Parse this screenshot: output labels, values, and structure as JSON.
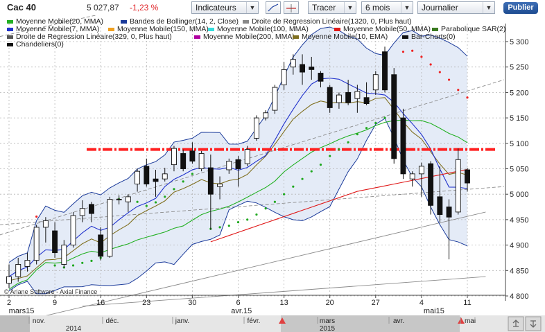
{
  "header": {
    "instrument": "Cac 40",
    "price": "5 027,87",
    "change": "-1,23 %",
    "indicators_label": "Indicateurs",
    "draw_label": "Tracer",
    "period_label": "6 mois",
    "interval_label": "Journalier",
    "publish_label": "Publier"
  },
  "legend": [
    {
      "label": "Moyenne Mobile(20, MMA)",
      "color": "#22b022"
    },
    {
      "label": "Bandes de Bollinger(14, 2, Close)",
      "color": "#1a3a9a"
    },
    {
      "label": "Droite de Regression Linéaire(1320, 0, Plus haut)",
      "color": "#888888"
    },
    {
      "label": "Moyenne Mobile(7, MMA)",
      "color": "#2233cc"
    },
    {
      "label": "Moyenne Mobile(150, MMA)",
      "color": "#f0a020"
    },
    {
      "label": "Moyenne Mobile(100, MMA)",
      "color": "#33dddd"
    },
    {
      "label": "Moyenne Mobile(50, MMA)",
      "color": "#e01818"
    },
    {
      "label": "Parabolique SAR(2)",
      "color": "#3a7a20"
    },
    {
      "label": "Droite de Regression Linéaire(329, 0, Plus haut)",
      "color": "#555555"
    },
    {
      "label": "Moyenne Mobile(200, MMA)",
      "color": "#b000a0"
    },
    {
      "label": "Moyenne Mobile(10, EMA)",
      "color": "#807020"
    },
    {
      "label": "Bar-Charts(0)",
      "color": "#111111"
    },
    {
      "label": "Chandeliers(0)",
      "color": "#111111"
    }
  ],
  "watermark": "© Ariane Software - Axial Finance",
  "chart_data": {
    "type": "candlestick",
    "ylim": [
      4800,
      5320
    ],
    "y_ticks": [
      4800,
      4850,
      4900,
      4950,
      5000,
      5050,
      5100,
      5150,
      5200,
      5250,
      5300
    ],
    "x_tick_labels": [
      "2",
      "9",
      "16",
      "23",
      "30",
      "6",
      "13",
      "20",
      "27",
      "4",
      "11"
    ],
    "x_tick_index": [
      0,
      5,
      10,
      15,
      20,
      25,
      30,
      35,
      40,
      45,
      50
    ],
    "month_labels": [
      {
        "label": "mars15",
        "index": 0
      },
      {
        "label": "avr.15",
        "index": 24
      },
      {
        "label": "mai15",
        "index": 45
      }
    ],
    "horizontal_line": {
      "value": 5088,
      "color": "#ff2020",
      "style": "dash-dot"
    },
    "candles": [
      [
        4825,
        4862,
        4815,
        4838
      ],
      [
        4838,
        4875,
        4828,
        4862
      ],
      [
        4858,
        4885,
        4848,
        4870
      ],
      [
        4870,
        4940,
        4862,
        4935
      ],
      [
        4935,
        4955,
        4905,
        4948
      ],
      [
        4928,
        4945,
        4875,
        4885
      ],
      [
        4862,
        4910,
        4855,
        4900
      ],
      [
        4900,
        4965,
        4895,
        4958
      ],
      [
        4958,
        4988,
        4945,
        4972
      ],
      [
        4980,
        4985,
        4945,
        4962
      ],
      [
        4920,
        4935,
        4870,
        4878
      ],
      [
        4878,
        4995,
        4875,
        4990
      ],
      [
        4990,
        4998,
        4980,
        4990
      ],
      [
        4985,
        5000,
        4965,
        4995
      ],
      [
        5020,
        5050,
        5005,
        5045
      ],
      [
        5055,
        5070,
        5015,
        5020
      ],
      [
        5030,
        5048,
        4995,
        5025
      ],
      [
        5030,
        5052,
        5025,
        5040
      ],
      [
        5058,
        5095,
        5045,
        5090
      ],
      [
        5080,
        5088,
        5045,
        5050
      ],
      [
        5085,
        5102,
        5060,
        5065
      ],
      [
        5050,
        5085,
        5045,
        5080
      ],
      [
        5052,
        5078,
        4930,
        5000
      ],
      [
        5015,
        5035,
        4990,
        5020
      ],
      [
        5048,
        5070,
        5040,
        5065
      ],
      [
        5068,
        5075,
        5015,
        5050
      ],
      [
        5060,
        5095,
        5055,
        5088
      ],
      [
        5110,
        5155,
        5105,
        5150
      ],
      [
        5150,
        5165,
        5145,
        5160
      ],
      [
        5165,
        5215,
        5158,
        5210
      ],
      [
        5215,
        5260,
        5205,
        5245
      ],
      [
        5250,
        5275,
        5235,
        5265
      ],
      [
        5255,
        5275,
        5215,
        5240
      ],
      [
        5250,
        5270,
        5225,
        5245
      ],
      [
        5238,
        5242,
        5210,
        5222
      ],
      [
        5210,
        5215,
        5160,
        5170
      ],
      [
        5180,
        5200,
        5168,
        5195
      ],
      [
        5200,
        5225,
        5175,
        5180
      ],
      [
        5188,
        5215,
        5160,
        5202
      ],
      [
        5190,
        5220,
        5175,
        5178
      ],
      [
        5205,
        5242,
        5195,
        5235
      ],
      [
        5280,
        5290,
        5200,
        5205
      ],
      [
        5235,
        5248,
        5060,
        5070
      ],
      [
        5150,
        5168,
        5030,
        5040
      ],
      [
        5030,
        5045,
        5015,
        5040
      ],
      [
        5040,
        5062,
        4995,
        5055
      ],
      [
        5060,
        5065,
        4960,
        4978
      ],
      [
        4995,
        5055,
        4945,
        4960
      ],
      [
        4975,
        4990,
        4872,
        4955
      ],
      [
        4965,
        5090,
        4960,
        5068
      ],
      [
        5048,
        5052,
        5005,
        5022
      ]
    ],
    "sar": [
      [
        3,
        4956
      ],
      [
        5,
        4860
      ],
      [
        6,
        4856
      ],
      [
        7,
        4860
      ],
      [
        8,
        4865
      ],
      [
        9,
        4869
      ],
      [
        10,
        4875
      ],
      [
        11,
        4978
      ],
      [
        12,
        4990
      ],
      [
        13,
        4992
      ],
      [
        14,
        4985
      ],
      [
        15,
        4977
      ],
      [
        16,
        4984
      ],
      [
        17,
        4995
      ],
      [
        18,
        5010
      ],
      [
        19,
        5025
      ],
      [
        20,
        5040
      ],
      [
        21,
        5062
      ],
      [
        22,
        4932
      ],
      [
        23,
        4935
      ],
      [
        24,
        4938
      ],
      [
        25,
        4945
      ],
      [
        26,
        4950
      ],
      [
        27,
        4960
      ],
      [
        28,
        4972
      ],
      [
        29,
        4985
      ],
      [
        30,
        5000
      ],
      [
        31,
        5015
      ],
      [
        32,
        5030
      ],
      [
        33,
        5045
      ],
      [
        34,
        5058
      ],
      [
        35,
        5075
      ],
      [
        36,
        5088
      ],
      [
        37,
        5102
      ],
      [
        38,
        5118
      ],
      [
        39,
        5130
      ],
      [
        40,
        5140
      ],
      [
        41,
        5150
      ],
      [
        42,
        5168
      ],
      [
        43,
        5280
      ],
      [
        44,
        5282
      ],
      [
        45,
        5270
      ],
      [
        46,
        5255
      ],
      [
        47,
        5240
      ],
      [
        48,
        5225
      ],
      [
        49,
        5205
      ],
      [
        50,
        5190
      ]
    ]
  },
  "timeline": {
    "months": [
      "nov.",
      "déc.",
      "janv.",
      "févr.",
      "mars",
      "avr.",
      "mai"
    ],
    "years": [
      "2014",
      "2015"
    ]
  }
}
